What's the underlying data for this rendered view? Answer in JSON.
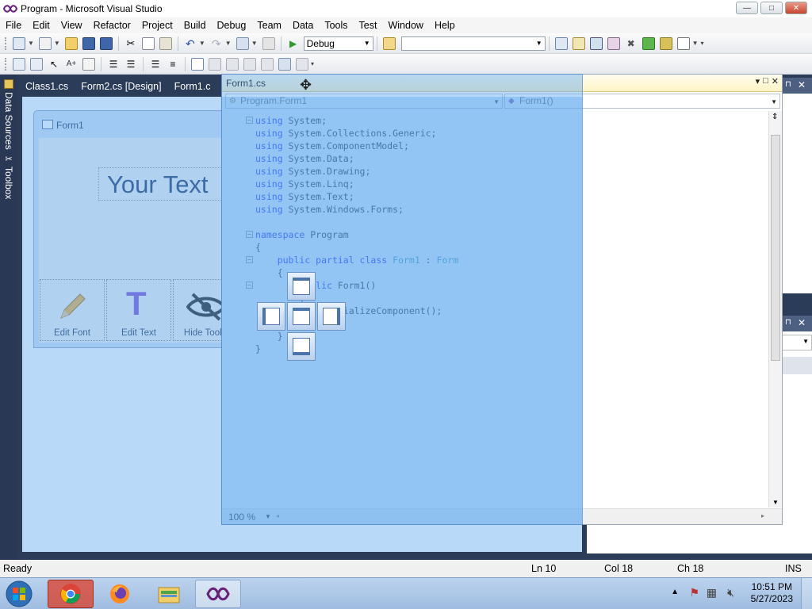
{
  "window": {
    "title": "Program - Microsoft Visual Studio",
    "min": "—",
    "max": "□",
    "close": "✕"
  },
  "menu": [
    "File",
    "Edit",
    "View",
    "Refactor",
    "Project",
    "Build",
    "Debug",
    "Team",
    "Data",
    "Tools",
    "Test",
    "Window",
    "Help"
  ],
  "toolbar": {
    "config": "Debug",
    "platform": ""
  },
  "left_dock": {
    "data_sources": "Data Sources",
    "toolbox": "Toolbox"
  },
  "doc_tabs": [
    {
      "label": "Class1.cs",
      "active": false
    },
    {
      "label": "Form2.cs [Design]",
      "active": false
    },
    {
      "label": "Form1.c",
      "active": false
    }
  ],
  "designer": {
    "form_title": "Form1",
    "big_label": "Your Text",
    "tool_buttons": [
      "Edit Font",
      "Edit Text",
      "Hide Toolb"
    ]
  },
  "code_window": {
    "title": "Form1.cs",
    "type_combo": "Program.Form1",
    "member_combo": "Form1()",
    "zoom": "100 %",
    "lines": [
      [
        {
          "k": "kw",
          "t": "using"
        },
        {
          "k": "",
          "t": " System;"
        }
      ],
      [
        {
          "k": "kw",
          "t": "using"
        },
        {
          "k": "",
          "t": " System.Collections.Generic;"
        }
      ],
      [
        {
          "k": "kw",
          "t": "using"
        },
        {
          "k": "",
          "t": " System.ComponentModel;"
        }
      ],
      [
        {
          "k": "kw",
          "t": "using"
        },
        {
          "k": "",
          "t": " System.Data;"
        }
      ],
      [
        {
          "k": "kw",
          "t": "using"
        },
        {
          "k": "",
          "t": " System.Drawing;"
        }
      ],
      [
        {
          "k": "kw",
          "t": "using"
        },
        {
          "k": "",
          "t": " System.Linq;"
        }
      ],
      [
        {
          "k": "kw",
          "t": "using"
        },
        {
          "k": "",
          "t": " System.Text;"
        }
      ],
      [
        {
          "k": "kw",
          "t": "using"
        },
        {
          "k": "",
          "t": " System.Windows.Forms;"
        }
      ],
      [],
      [
        {
          "k": "kw",
          "t": "namespace"
        },
        {
          "k": "",
          "t": " Program"
        }
      ],
      [
        {
          "k": "",
          "t": "{"
        }
      ],
      [
        {
          "k": "",
          "t": "    "
        },
        {
          "k": "kw",
          "t": "public partial class"
        },
        {
          "k": "",
          "t": " "
        },
        {
          "k": "ty",
          "t": "Form1"
        },
        {
          "k": "",
          "t": " : "
        },
        {
          "k": "ty",
          "t": "Form"
        }
      ],
      [
        {
          "k": "",
          "t": "    {"
        }
      ],
      [
        {
          "k": "",
          "t": "        "
        },
        {
          "k": "kw",
          "t": "public"
        },
        {
          "k": "",
          "t": " Form1()"
        }
      ],
      [
        {
          "k": "",
          "t": "        {"
        }
      ],
      [
        {
          "k": "",
          "t": "            InitializeComponent();"
        }
      ],
      [
        {
          "k": "",
          "t": "        }"
        }
      ],
      [
        {
          "k": "",
          "t": "    }"
        }
      ],
      [
        {
          "k": "",
          "t": "}"
        }
      ]
    ]
  },
  "status": {
    "ready": "Ready",
    "ln": "Ln 10",
    "col": "Col 18",
    "ch": "Ch 18",
    "ins": "INS"
  },
  "clock": {
    "time": "10:51 PM",
    "date": "5/27/2023"
  },
  "colors": {
    "ide_bg": "#2b3c59",
    "overlay": "#64aaf0",
    "keyword": "#0000ff",
    "type": "#2b91af"
  }
}
